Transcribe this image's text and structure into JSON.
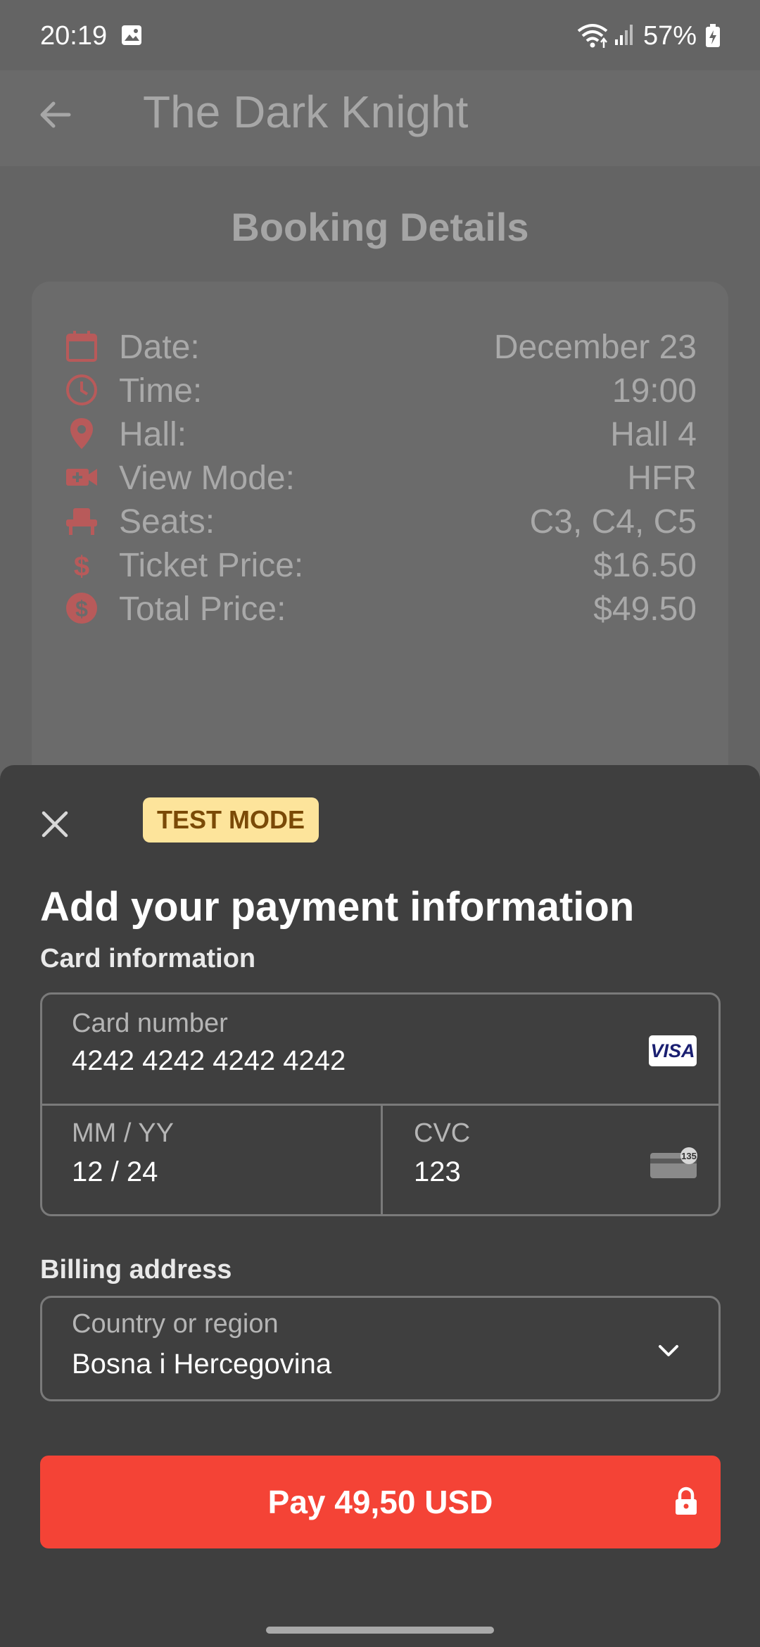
{
  "status_bar": {
    "time": "20:19",
    "battery": "57%"
  },
  "app_bar": {
    "title": "The Dark Knight"
  },
  "booking": {
    "title": "Booking Details",
    "rows": [
      {
        "icon": "calendar-icon",
        "label": "Date:",
        "value": "December 23"
      },
      {
        "icon": "clock-icon",
        "label": "Time:",
        "value": "19:00"
      },
      {
        "icon": "location-pin-icon",
        "label": "Hall:",
        "value": "Hall 4"
      },
      {
        "icon": "video-camera-icon",
        "label": "View Mode:",
        "value": "HFR"
      },
      {
        "icon": "seat-icon",
        "label": "Seats:",
        "value": "C3, C4, C5"
      },
      {
        "icon": "dollar-icon",
        "label": "Ticket Price:",
        "value": "$16.50"
      },
      {
        "icon": "dollar-circle-icon",
        "label": "Total Price:",
        "value": "$49.50"
      }
    ]
  },
  "payment_sheet": {
    "badge": "TEST MODE",
    "title": "Add your payment information",
    "card_info_label": "Card information",
    "card_number": {
      "label": "Card number",
      "value": "4242 4242 4242 4242",
      "brand": "VISA"
    },
    "expiry": {
      "label": "MM / YY",
      "value": "12 / 24"
    },
    "cvc": {
      "label": "CVC",
      "value": "123",
      "hint": "135"
    },
    "billing_label": "Billing address",
    "country": {
      "label": "Country or region",
      "value": "Bosna i Hercegovina"
    },
    "pay_button": "Pay 49,50 USD"
  },
  "colors": {
    "accent_red": "#f44336",
    "badge_bg": "#fde49b",
    "badge_text": "#7a4a07",
    "detail_icon": "#b85a5a"
  }
}
